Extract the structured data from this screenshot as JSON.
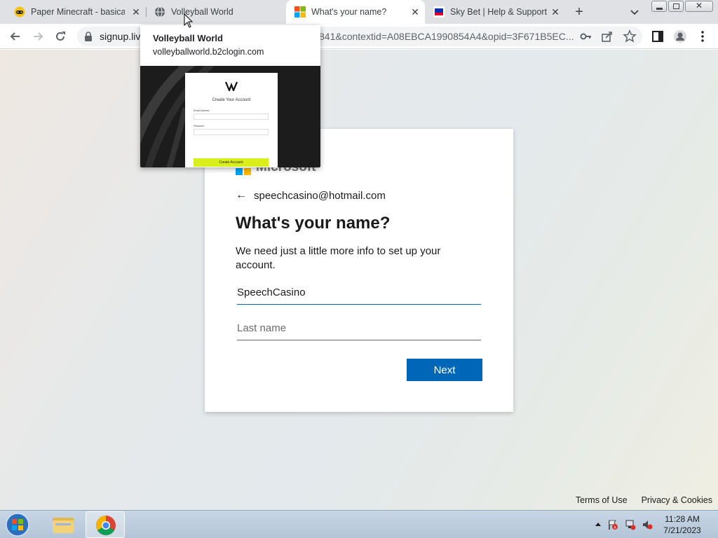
{
  "tabs": [
    {
      "title": "Paper Minecraft - basically",
      "icon": "gamepad-icon",
      "active": false
    },
    {
      "title": "Volleyball World",
      "icon": "globe-icon",
      "active": false
    },
    {
      "title": "What's your name?",
      "icon": "microsoft-logo-icon",
      "active": true
    },
    {
      "title": "Sky Bet | Help & Support",
      "icon": "skybet-icon",
      "active": false
    }
  ],
  "toolbar": {
    "url_start": "signup.liv",
    "url_tail": "841&contextid=A08EBCA1990854A4&opid=3F671B5EC..."
  },
  "hovercard": {
    "title": "Volleyball World",
    "domain": "volleyballworld.b2clogin.com",
    "preview": {
      "heading": "Create Your Account",
      "email_label": "Email Address",
      "password_label": "Password",
      "button": "Create Account"
    }
  },
  "card": {
    "brand": "Microsoft",
    "email": "speechcasino@hotmail.com",
    "title": "What's your name?",
    "description": "We need just a little more info to set up your account.",
    "first_name_value": "SpeechCasino",
    "last_name_placeholder": "Last name",
    "next_label": "Next"
  },
  "footer": {
    "terms": "Terms of Use",
    "privacy": "Privacy & Cookies"
  },
  "taskbar": {
    "time": "11:28 AM",
    "date": "7/21/2023"
  },
  "colors": {
    "accent": "#0067b8",
    "tabstrip": "#dfe1e5"
  }
}
